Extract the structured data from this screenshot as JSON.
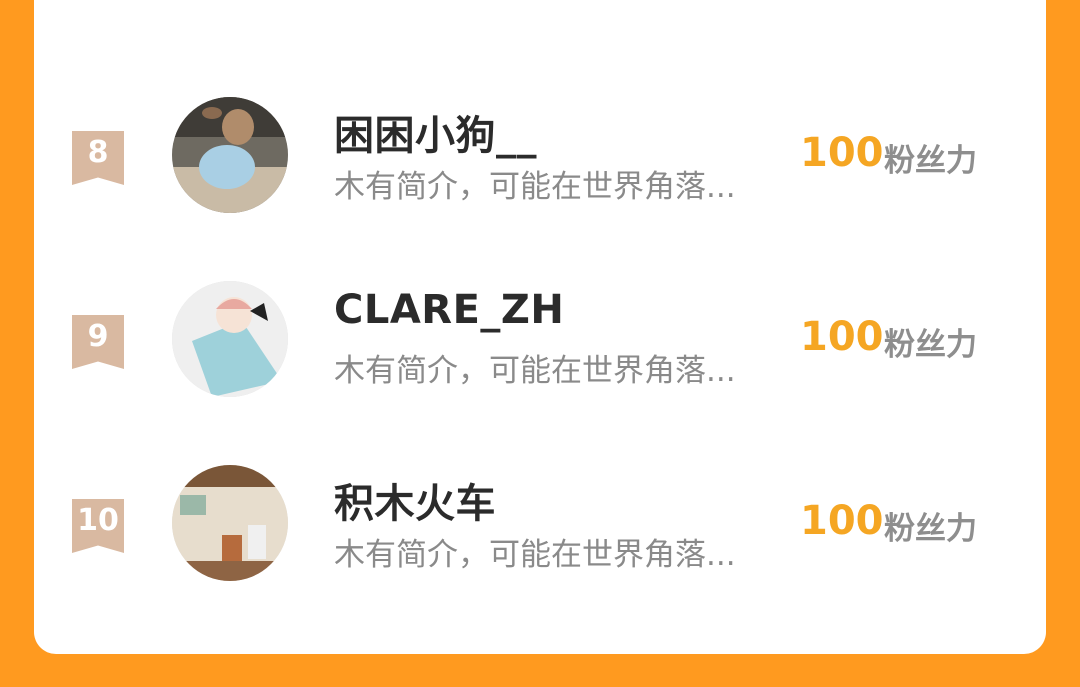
{
  "list": {
    "rows": [
      {
        "rank": "8",
        "name": "困困小狗__",
        "bio": "木有简介，可能在世界角落...",
        "score": "100",
        "unit": "粉丝力",
        "avatar_icon": "dog-avatar-icon"
      },
      {
        "rank": "9",
        "name": "CLARE_ZH",
        "bio": "木有简介，可能在世界角落...",
        "score": "100",
        "unit": "粉丝力",
        "avatar_icon": "anime-girl-avatar-icon"
      },
      {
        "rank": "10",
        "name": "积木火车",
        "bio": "木有简介，可能在世界角落...",
        "score": "100",
        "unit": "粉丝力",
        "avatar_icon": "shop-interior-avatar-icon"
      }
    ]
  },
  "colors": {
    "background": "#FF9A1F",
    "card": "#FFFFFF",
    "score": "#F5A623",
    "rank_badge": "#D9B9A1"
  }
}
